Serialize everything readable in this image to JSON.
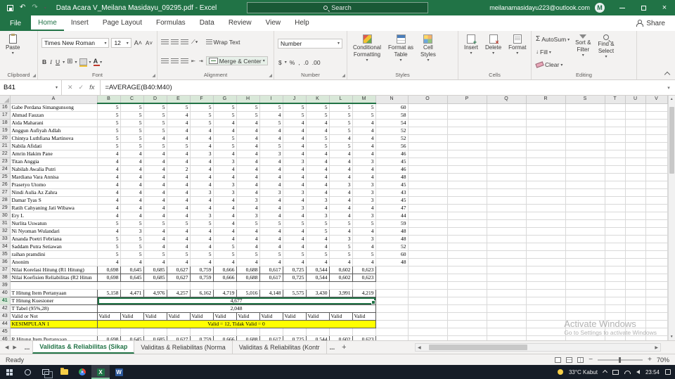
{
  "title_bar": {
    "title": "Data Acara V_Meilana Masidayu_09295.pdf - Excel",
    "search_placeholder": "Search",
    "account_email": "meilanamasidayu223@outlook.com",
    "account_initial": "M"
  },
  "ribbon": {
    "tabs": [
      "File",
      "Home",
      "Insert",
      "Page Layout",
      "Formulas",
      "Data",
      "Review",
      "View",
      "Help"
    ],
    "active_tab": "Home",
    "share": "Share",
    "groups": {
      "clipboard": {
        "label": "Clipboard",
        "paste": "Paste"
      },
      "font": {
        "label": "Font",
        "name": "Times New Roman",
        "size": "12",
        "bold": "B",
        "italic": "I",
        "underline": "U"
      },
      "alignment": {
        "label": "Alignment",
        "wrap": "Wrap Text",
        "merge": "Merge & Center"
      },
      "number": {
        "label": "Number",
        "format": "Number",
        "currency": "$",
        "percent": "%",
        "comma": ",",
        "dec_inc": ".0",
        "dec_dec": ".00"
      },
      "styles": {
        "label": "Styles",
        "cond1": "Conditional",
        "cond2": "Formatting",
        "table1": "Format as",
        "table2": "Table",
        "cell1": "Cell",
        "cell2": "Styles"
      },
      "cells": {
        "label": "Cells",
        "insert": "Insert",
        "delete": "Delete",
        "format": "Format"
      },
      "editing": {
        "label": "Editing",
        "autosum": "AutoSum",
        "fill": "Fill",
        "clear": "Clear",
        "sort1": "Sort &",
        "sort2": "Filter",
        "find1": "Find &",
        "find2": "Select"
      }
    }
  },
  "formula_bar": {
    "name_box": "B41",
    "cancel": "✕",
    "enter": "✓",
    "fx": "fx",
    "formula": "=AVERAGE(B40:M40)"
  },
  "grid": {
    "col_headers": [
      "A",
      "B",
      "C",
      "D",
      "E",
      "F",
      "G",
      "H",
      "I",
      "J",
      "K",
      "L",
      "M",
      "N",
      "O",
      "P",
      "Q",
      "R",
      "S",
      "T",
      "U",
      "V"
    ],
    "selected_cols": [
      "B",
      "C",
      "D",
      "E",
      "F",
      "G",
      "H",
      "I",
      "J",
      "K",
      "L",
      "M"
    ],
    "selected_row": 41,
    "rows": [
      {
        "num": 16,
        "name": "Gabe Perdana Simangunsong",
        "values": [
          "5",
          "5",
          "5",
          "5",
          "5",
          "5",
          "5",
          "5",
          "5",
          "5",
          "5",
          "5"
        ],
        "total": "60"
      },
      {
        "num": 17,
        "name": "Ahmad Fauzan",
        "values": [
          "5",
          "5",
          "5",
          "4",
          "5",
          "5",
          "5",
          "4",
          "5",
          "5",
          "5",
          "5"
        ],
        "total": "58"
      },
      {
        "num": 18,
        "name": "Aida Maharani",
        "values": [
          "5",
          "5",
          "5",
          "4",
          "5",
          "4",
          "4",
          "5",
          "4",
          "4",
          "5",
          "4"
        ],
        "total": "54"
      },
      {
        "num": 19,
        "name": "Anggun Aufiyah Adlah",
        "values": [
          "5",
          "5",
          "5",
          "4",
          "4",
          "4",
          "4",
          "4",
          "4",
          "4",
          "5",
          "4"
        ],
        "total": "52"
      },
      {
        "num": 20,
        "name": "Chintya Luthfiana Martinova",
        "values": [
          "5",
          "5",
          "4",
          "4",
          "4",
          "5",
          "4",
          "4",
          "4",
          "5",
          "4",
          "4"
        ],
        "total": "52"
      },
      {
        "num": 21,
        "name": "Nabila Afidati",
        "values": [
          "5",
          "5",
          "5",
          "5",
          "4",
          "5",
          "4",
          "5",
          "4",
          "5",
          "5",
          "4"
        ],
        "total": "56"
      },
      {
        "num": 22,
        "name": "Amrin Hakim Pane",
        "values": [
          "4",
          "4",
          "4",
          "4",
          "3",
          "4",
          "4",
          "3",
          "4",
          "4",
          "4",
          "4"
        ],
        "total": "46"
      },
      {
        "num": 23,
        "name": "Titan Anggia",
        "values": [
          "4",
          "4",
          "4",
          "4",
          "4",
          "3",
          "4",
          "4",
          "3",
          "4",
          "4",
          "3"
        ],
        "total": "45"
      },
      {
        "num": 24,
        "name": "Nabilah Awalia Putri",
        "values": [
          "4",
          "4",
          "4",
          "2",
          "4",
          "4",
          "4",
          "4",
          "4",
          "4",
          "4",
          "4"
        ],
        "total": "46"
      },
      {
        "num": 25,
        "name": "Mardiana Vara Annisa",
        "values": [
          "4",
          "4",
          "4",
          "4",
          "4",
          "4",
          "4",
          "4",
          "4",
          "4",
          "4",
          "4"
        ],
        "total": "48"
      },
      {
        "num": 26,
        "name": "Prasetyo Utomo",
        "values": [
          "4",
          "4",
          "4",
          "4",
          "4",
          "3",
          "4",
          "4",
          "4",
          "4",
          "3",
          "3"
        ],
        "total": "45"
      },
      {
        "num": 27,
        "name": "Nindi Aulia Az Zahra",
        "values": [
          "4",
          "4",
          "4",
          "4",
          "3",
          "3",
          "4",
          "3",
          "3",
          "4",
          "4",
          "3"
        ],
        "total": "43"
      },
      {
        "num": 28,
        "name": "Damar Tyas S",
        "values": [
          "4",
          "4",
          "4",
          "4",
          "4",
          "4",
          "3",
          "4",
          "4",
          "3",
          "4",
          "3"
        ],
        "total": "45"
      },
      {
        "num": 29,
        "name": "Ratih Cahyaning Jati Wibawa",
        "values": [
          "4",
          "4",
          "4",
          "4",
          "4",
          "4",
          "4",
          "4",
          "3",
          "4",
          "4",
          "4"
        ],
        "total": "47"
      },
      {
        "num": 30,
        "name": "Ery L",
        "values": [
          "4",
          "4",
          "4",
          "4",
          "3",
          "4",
          "3",
          "4",
          "4",
          "3",
          "4",
          "3"
        ],
        "total": "44"
      },
      {
        "num": 31,
        "name": "Nurlita Uswatun",
        "values": [
          "5",
          "5",
          "5",
          "5",
          "5",
          "4",
          "5",
          "5",
          "5",
          "5",
          "5",
          "5"
        ],
        "total": "59"
      },
      {
        "num": 32,
        "name": "Ni Nyoman Wulandari",
        "values": [
          "4",
          "3",
          "4",
          "4",
          "4",
          "4",
          "4",
          "4",
          "4",
          "5",
          "4",
          "4"
        ],
        "total": "48"
      },
      {
        "num": 33,
        "name": "Ananda Poetri Febriana",
        "values": [
          "5",
          "5",
          "4",
          "4",
          "4",
          "4",
          "4",
          "4",
          "4",
          "4",
          "3",
          "3"
        ],
        "total": "48"
      },
      {
        "num": 34,
        "name": "Saddam Putra Setiawan",
        "values": [
          "5",
          "5",
          "4",
          "4",
          "4",
          "5",
          "4",
          "4",
          "4",
          "4",
          "5",
          "4"
        ],
        "total": "52"
      },
      {
        "num": 35,
        "name": "raihan pramdini",
        "values": [
          "5",
          "5",
          "5",
          "5",
          "5",
          "5",
          "5",
          "5",
          "5",
          "5",
          "5",
          "5"
        ],
        "total": "60"
      },
      {
        "num": 36,
        "name": "Anonim",
        "values": [
          "4",
          "4",
          "4",
          "4",
          "4",
          "4",
          "4",
          "4",
          "4",
          "4",
          "4",
          "4"
        ],
        "total": "48"
      },
      {
        "num": 37,
        "name": "Nilai Korelasi Hitung (R1 Hitung)",
        "values": [
          "0,698",
          "0,645",
          "0,685",
          "0,627",
          "0,759",
          "0,666",
          "0,688",
          "0,617",
          "0,725",
          "0,544",
          "0,602",
          "0,623"
        ],
        "total": "",
        "bordered": true
      },
      {
        "num": 38,
        "name": "Nilai Koefisien Reliabilitas (R2 Hitun",
        "values": [
          "0,698",
          "0,645",
          "0,685",
          "0,627",
          "0,759",
          "0,666",
          "0,688",
          "0,617",
          "0,725",
          "0,544",
          "0,602",
          "0,623"
        ],
        "total": "",
        "bordered": true
      },
      {
        "num": 39,
        "name": "",
        "values": [],
        "total": ""
      },
      {
        "num": 40,
        "name": "T Hitung Item Pertanyaan",
        "values": [
          "5,158",
          "4,471",
          "4,976",
          "4,257",
          "6,162",
          "4,719",
          "5,016",
          "4,148",
          "5,575",
          "3,430",
          "3,991",
          "4,219"
        ],
        "total": "",
        "bordered": true
      },
      {
        "num": 41,
        "name": "T Hitung Kuesioner",
        "merged": "4,677",
        "bordered": true,
        "selected": true
      },
      {
        "num": 42,
        "name": "T Tabel (95%,28)",
        "merged": "2,048",
        "bordered": true
      },
      {
        "num": 43,
        "name": "Valid or Not",
        "values": [
          "Valid",
          "Valid",
          "Valid",
          "Valid",
          "Valid",
          "Valid",
          "Valid",
          "Valid",
          "Valid",
          "Valid",
          "Valid",
          "Valid"
        ],
        "total": "",
        "bordered": true,
        "text_cells": true
      },
      {
        "num": 44,
        "name": "KESIMPULAN 1",
        "merged": "Valid = 12, Tidak Valid = 0",
        "bordered": true,
        "highlight": "yellow"
      },
      {
        "num": 45,
        "name": "",
        "values": [],
        "total": ""
      },
      {
        "num": 46,
        "name": "R Hitung Item Pertanyaan",
        "values": [
          "0,698",
          "0,645",
          "0,685",
          "0,627",
          "0,759",
          "0,666",
          "0,688",
          "0,617",
          "0,725",
          "0,544",
          "0,602",
          "0,623"
        ],
        "total": "",
        "bordered": true
      }
    ]
  },
  "watermark": {
    "line1": "Activate Windows",
    "line2": "Go to Settings to activate Windows"
  },
  "sheet_bar": {
    "more_left": "...",
    "more_right": "...",
    "tabs": [
      {
        "label": "Validitas & Reliabilitas (Sikap",
        "active": true
      },
      {
        "label": "Validitas & Reliabilitas (Norma",
        "active": false
      },
      {
        "label": "Validitas & Reliabilitas (Kontr",
        "active": false
      }
    ],
    "add": "+"
  },
  "status_bar": {
    "status": "Ready",
    "zoom": "70%"
  },
  "taskbar": {
    "weather": "33°C  Kabut",
    "time": "23:54"
  }
}
